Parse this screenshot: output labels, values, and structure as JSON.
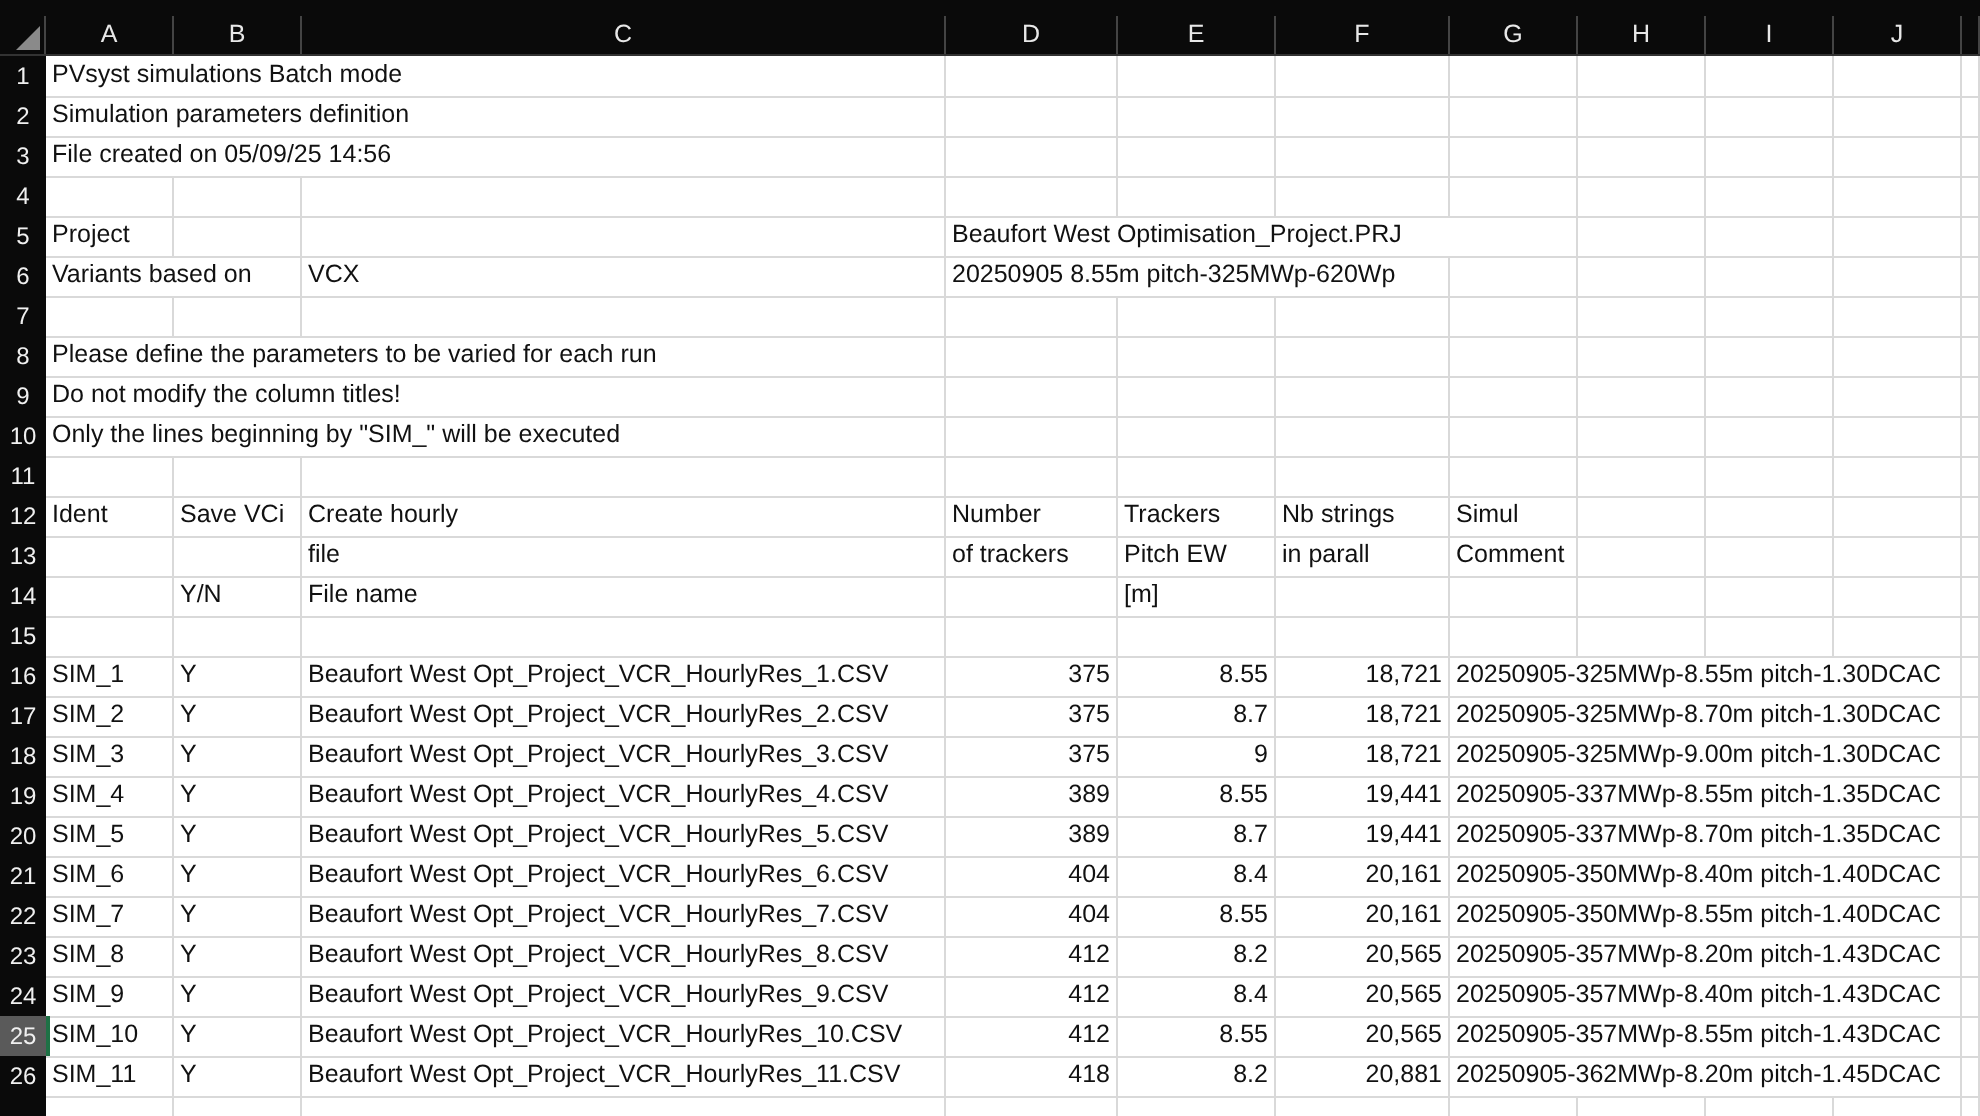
{
  "columns": [
    "A",
    "B",
    "C",
    "D",
    "E",
    "F",
    "G",
    "H",
    "I",
    "J"
  ],
  "rows": [
    {
      "number": "1",
      "selected": false,
      "cells": [
        {
          "text": "PVsyst simulations Batch mode",
          "kind": "text"
        }
      ]
    },
    {
      "number": "2",
      "selected": false,
      "cells": [
        {
          "text": "Simulation parameters definition",
          "kind": "text"
        }
      ]
    },
    {
      "number": "3",
      "selected": false,
      "cells": [
        {
          "text": "File created on 05/09/25 14:56",
          "kind": "text"
        }
      ]
    },
    {
      "number": "4",
      "selected": false,
      "cells": []
    },
    {
      "number": "5",
      "selected": false,
      "cells": [
        {
          "text": "Project",
          "kind": "text"
        },
        null,
        null,
        {
          "text": "Beaufort West Optimisation_Project.PRJ",
          "kind": "text"
        }
      ]
    },
    {
      "number": "6",
      "selected": false,
      "cells": [
        {
          "text": "Variants based on",
          "kind": "text"
        },
        null,
        {
          "text": "VCX",
          "kind": "text"
        },
        {
          "text": "20250905 8.55m pitch-325MWp-620Wp",
          "kind": "text"
        }
      ]
    },
    {
      "number": "7",
      "selected": false,
      "cells": []
    },
    {
      "number": "8",
      "selected": false,
      "cells": [
        {
          "text": "Please define the parameters to be varied for each run",
          "kind": "text"
        }
      ]
    },
    {
      "number": "9",
      "selected": false,
      "cells": [
        {
          "text": "Do not modify the column titles!",
          "kind": "text"
        }
      ]
    },
    {
      "number": "10",
      "selected": false,
      "cells": [
        {
          "text": "Only the lines beginning by \"SIM_\" will be executed",
          "kind": "text"
        }
      ]
    },
    {
      "number": "11",
      "selected": false,
      "cells": []
    },
    {
      "number": "12",
      "selected": false,
      "cells": [
        {
          "text": "Ident",
          "kind": "text"
        },
        {
          "text": "Save VCi",
          "kind": "text"
        },
        {
          "text": "Create hourly",
          "kind": "text"
        },
        {
          "text": "Number",
          "kind": "text"
        },
        {
          "text": "Trackers",
          "kind": "text"
        },
        {
          "text": "Nb strings",
          "kind": "text"
        },
        {
          "text": "Simul",
          "kind": "text"
        }
      ]
    },
    {
      "number": "13",
      "selected": false,
      "cells": [
        null,
        null,
        {
          "text": "file",
          "kind": "text"
        },
        {
          "text": "of trackers",
          "kind": "text"
        },
        {
          "text": "Pitch EW",
          "kind": "text"
        },
        {
          "text": "in parall",
          "kind": "text"
        },
        {
          "text": "Comment",
          "kind": "text"
        }
      ]
    },
    {
      "number": "14",
      "selected": false,
      "cells": [
        null,
        {
          "text": "Y/N",
          "kind": "text"
        },
        {
          "text": "File name",
          "kind": "text"
        },
        null,
        {
          "text": "[m]",
          "kind": "text"
        }
      ]
    },
    {
      "number": "15",
      "selected": false,
      "cells": []
    },
    {
      "number": "16",
      "selected": false,
      "cells": [
        {
          "text": "SIM_1",
          "kind": "text"
        },
        {
          "text": "Y",
          "kind": "text"
        },
        {
          "text": "Beaufort West Opt_Project_VCR_HourlyRes_1.CSV",
          "kind": "text"
        },
        {
          "text": "375",
          "kind": "number"
        },
        {
          "text": "8.55",
          "kind": "number"
        },
        {
          "text": "18,721",
          "kind": "number"
        },
        {
          "text": "20250905-325MWp-8.55m pitch-1.30DCAC",
          "kind": "text"
        }
      ]
    },
    {
      "number": "17",
      "selected": false,
      "cells": [
        {
          "text": "SIM_2",
          "kind": "text"
        },
        {
          "text": "Y",
          "kind": "text"
        },
        {
          "text": "Beaufort West Opt_Project_VCR_HourlyRes_2.CSV",
          "kind": "text"
        },
        {
          "text": "375",
          "kind": "number"
        },
        {
          "text": "8.7",
          "kind": "number"
        },
        {
          "text": "18,721",
          "kind": "number"
        },
        {
          "text": "20250905-325MWp-8.70m pitch-1.30DCAC",
          "kind": "text"
        }
      ]
    },
    {
      "number": "18",
      "selected": false,
      "cells": [
        {
          "text": "SIM_3",
          "kind": "text"
        },
        {
          "text": "Y",
          "kind": "text"
        },
        {
          "text": "Beaufort West Opt_Project_VCR_HourlyRes_3.CSV",
          "kind": "text"
        },
        {
          "text": "375",
          "kind": "number"
        },
        {
          "text": "9",
          "kind": "number"
        },
        {
          "text": "18,721",
          "kind": "number"
        },
        {
          "text": "20250905-325MWp-9.00m pitch-1.30DCAC",
          "kind": "text"
        }
      ]
    },
    {
      "number": "19",
      "selected": false,
      "cells": [
        {
          "text": "SIM_4",
          "kind": "text"
        },
        {
          "text": "Y",
          "kind": "text"
        },
        {
          "text": "Beaufort West Opt_Project_VCR_HourlyRes_4.CSV",
          "kind": "text"
        },
        {
          "text": "389",
          "kind": "number"
        },
        {
          "text": "8.55",
          "kind": "number"
        },
        {
          "text": "19,441",
          "kind": "number"
        },
        {
          "text": "20250905-337MWp-8.55m pitch-1.35DCAC",
          "kind": "text"
        }
      ]
    },
    {
      "number": "20",
      "selected": false,
      "cells": [
        {
          "text": "SIM_5",
          "kind": "text"
        },
        {
          "text": "Y",
          "kind": "text"
        },
        {
          "text": "Beaufort West Opt_Project_VCR_HourlyRes_5.CSV",
          "kind": "text"
        },
        {
          "text": "389",
          "kind": "number"
        },
        {
          "text": "8.7",
          "kind": "number"
        },
        {
          "text": "19,441",
          "kind": "number"
        },
        {
          "text": "20250905-337MWp-8.70m pitch-1.35DCAC",
          "kind": "text"
        }
      ]
    },
    {
      "number": "21",
      "selected": false,
      "cells": [
        {
          "text": "SIM_6",
          "kind": "text"
        },
        {
          "text": "Y",
          "kind": "text"
        },
        {
          "text": "Beaufort West Opt_Project_VCR_HourlyRes_6.CSV",
          "kind": "text"
        },
        {
          "text": "404",
          "kind": "number"
        },
        {
          "text": "8.4",
          "kind": "number"
        },
        {
          "text": "20,161",
          "kind": "number"
        },
        {
          "text": "20250905-350MWp-8.40m pitch-1.40DCAC",
          "kind": "text"
        }
      ]
    },
    {
      "number": "22",
      "selected": false,
      "cells": [
        {
          "text": "SIM_7",
          "kind": "text"
        },
        {
          "text": "Y",
          "kind": "text"
        },
        {
          "text": "Beaufort West Opt_Project_VCR_HourlyRes_7.CSV",
          "kind": "text"
        },
        {
          "text": "404",
          "kind": "number"
        },
        {
          "text": "8.55",
          "kind": "number"
        },
        {
          "text": "20,161",
          "kind": "number"
        },
        {
          "text": "20250905-350MWp-8.55m pitch-1.40DCAC",
          "kind": "text"
        }
      ]
    },
    {
      "number": "23",
      "selected": false,
      "cells": [
        {
          "text": "SIM_8",
          "kind": "text"
        },
        {
          "text": "Y",
          "kind": "text"
        },
        {
          "text": "Beaufort West Opt_Project_VCR_HourlyRes_8.CSV",
          "kind": "text"
        },
        {
          "text": "412",
          "kind": "number"
        },
        {
          "text": "8.2",
          "kind": "number"
        },
        {
          "text": "20,565",
          "kind": "number"
        },
        {
          "text": "20250905-357MWp-8.20m pitch-1.43DCAC",
          "kind": "text"
        }
      ]
    },
    {
      "number": "24",
      "selected": false,
      "cells": [
        {
          "text": "SIM_9",
          "kind": "text"
        },
        {
          "text": "Y",
          "kind": "text"
        },
        {
          "text": "Beaufort West Opt_Project_VCR_HourlyRes_9.CSV",
          "kind": "text"
        },
        {
          "text": "412",
          "kind": "number"
        },
        {
          "text": "8.4",
          "kind": "number"
        },
        {
          "text": "20,565",
          "kind": "number"
        },
        {
          "text": "20250905-357MWp-8.40m pitch-1.43DCAC",
          "kind": "text"
        }
      ]
    },
    {
      "number": "25",
      "selected": true,
      "cells": [
        {
          "text": "SIM_10",
          "kind": "text"
        },
        {
          "text": "Y",
          "kind": "text"
        },
        {
          "text": "Beaufort West Opt_Project_VCR_HourlyRes_10.CSV",
          "kind": "text"
        },
        {
          "text": "412",
          "kind": "number"
        },
        {
          "text": "8.55",
          "kind": "number"
        },
        {
          "text": "20,565",
          "kind": "number"
        },
        {
          "text": "20250905-357MWp-8.55m pitch-1.43DCAC",
          "kind": "text"
        }
      ]
    },
    {
      "number": "26",
      "selected": false,
      "cells": [
        {
          "text": "SIM_11",
          "kind": "text"
        },
        {
          "text": "Y",
          "kind": "text"
        },
        {
          "text": "Beaufort West Opt_Project_VCR_HourlyRes_11.CSV",
          "kind": "text"
        },
        {
          "text": "418",
          "kind": "number"
        },
        {
          "text": "8.2",
          "kind": "number"
        },
        {
          "text": "20,881",
          "kind": "number"
        },
        {
          "text": "20250905-362MWp-8.20m pitch-1.45DCAC",
          "kind": "text"
        }
      ]
    },
    {
      "selected": false,
      "cells": []
    }
  ]
}
